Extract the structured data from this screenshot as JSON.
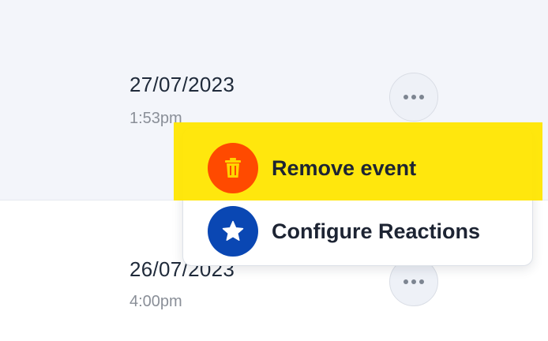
{
  "rows": [
    {
      "date": "27/07/2023",
      "time": "1:53pm"
    },
    {
      "date": "26/07/2023",
      "time": "4:00pm"
    }
  ],
  "menu": {
    "items": [
      {
        "label": "Remove event",
        "icon": "trash-icon",
        "color": "#ff4a00"
      },
      {
        "label": "Configure Reactions",
        "icon": "star-icon",
        "color": "#0a47b3"
      }
    ]
  },
  "colors": {
    "highlight": "#ffe600",
    "row_background": "#f3f5fa"
  }
}
